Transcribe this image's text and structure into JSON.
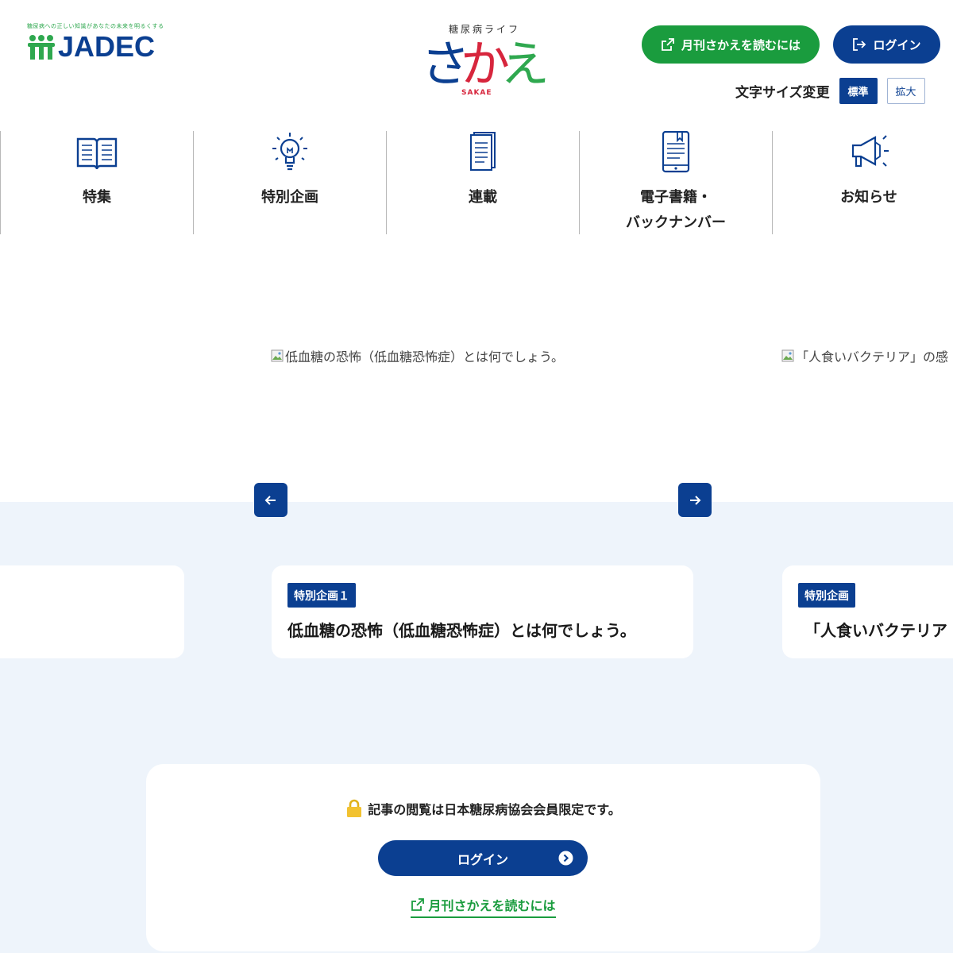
{
  "header": {
    "jadec_tagline": "糖尿病への正しい知識があなたの未来を明るくする",
    "jadec_name": "JADEC",
    "sakae_sub": "糖尿病ライフ",
    "sakae_chars": [
      "さ",
      "か",
      "え"
    ],
    "sakae_en": "SAKAE",
    "read_magazine_label": "月刊さかえを読むには",
    "login_label": "ログイン",
    "font_size_label": "文字サイズ変更",
    "font_size_standard": "標準",
    "font_size_large": "拡大"
  },
  "nav": {
    "items": [
      {
        "label": "特集",
        "icon": "book-icon"
      },
      {
        "label": "特別企画",
        "icon": "lightbulb-icon"
      },
      {
        "label": "連載",
        "icon": "documents-icon"
      },
      {
        "label": "電子書籍・\nバックナンバー",
        "icon": "ebook-icon"
      },
      {
        "label": "お知らせ",
        "icon": "megaphone-icon"
      }
    ]
  },
  "carousel": {
    "slides": [
      {
        "image_alt": "低血糖の恐怖（低血糖恐怖症）とは何でしょう。",
        "badge": "特別企画１",
        "title": "低血糖の恐怖（低血糖恐怖症）とは何でしょう。"
      },
      {
        "image_alt": "「人食いバクテリア」の感",
        "badge": "特別企画",
        "title": "「人食いバクテリア"
      }
    ],
    "prev_icon": "arrow-left-icon",
    "next_icon": "arrow-right-icon"
  },
  "login_panel": {
    "notice": "記事の閲覧は日本糖尿病協会会員限定です。",
    "login_label": "ログイン",
    "read_link": "月刊さかえを読むには"
  },
  "colors": {
    "brand_blue": "#0b3f91",
    "brand_green": "#1a9c3e",
    "sakae_red": "#d7263d",
    "band_bg": "#eef4fb"
  }
}
